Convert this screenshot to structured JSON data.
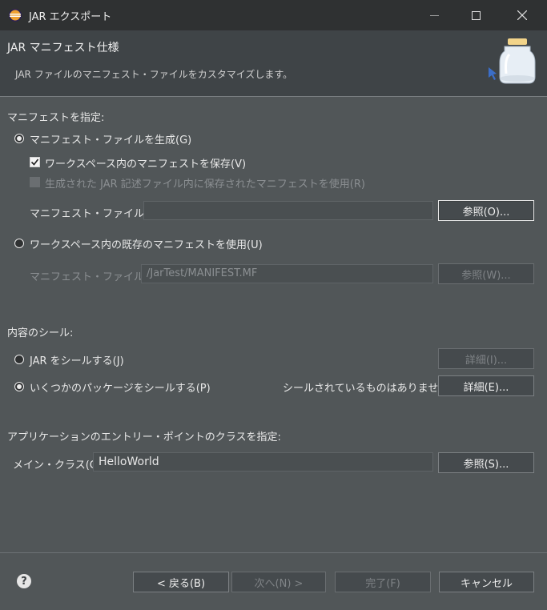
{
  "window": {
    "title": "JAR エクスポート",
    "minimize_glyph": "—",
    "maximize_glyph": "☐",
    "close_glyph": "✕"
  },
  "header": {
    "heading": "JAR マニフェスト仕様",
    "description": "JAR ファイルのマニフェスト・ファイルをカスタマイズします。"
  },
  "manifest": {
    "section_label": "マニフェストを指定:",
    "generate_radio": "マニフェスト・ファイルを生成(G)",
    "save_in_workspace": "ワークスペース内のマニフェストを保存(V)",
    "use_saved_in_jar_desc": "生成された JAR 記述ファイル内に保存されたマニフェストを使用(R)",
    "manifest_file_label": "マニフェスト・ファイル(M):",
    "manifest_file_value": "",
    "browse_o": "参照(O)...",
    "use_existing_radio": "ワークスペース内の既存のマニフェストを使用(U)",
    "existing_file_label": "マニフェスト・ファイル(A):",
    "existing_file_value": "/JarTest/MANIFEST.MF",
    "browse_w": "参照(W)..."
  },
  "seal": {
    "section_label": "内容のシール:",
    "seal_jar_radio": "JAR をシールする(J)",
    "details_i": "詳細(I)...",
    "seal_some_radio": "いくつかのパッケージをシールする(P)",
    "status": "シールされているものはありません",
    "details_e": "詳細(E)..."
  },
  "entry": {
    "section_label": "アプリケーションのエントリー・ポイントのクラスを指定:",
    "main_class_label": "メイン・クラス(C):",
    "main_class_value": "HelloWorld",
    "browse_s": "参照(S)..."
  },
  "footer": {
    "help_glyph": "?",
    "back": "< 戻る(B)",
    "next": "次へ(N) >",
    "finish": "完了(F)",
    "cancel": "キャンセル"
  }
}
